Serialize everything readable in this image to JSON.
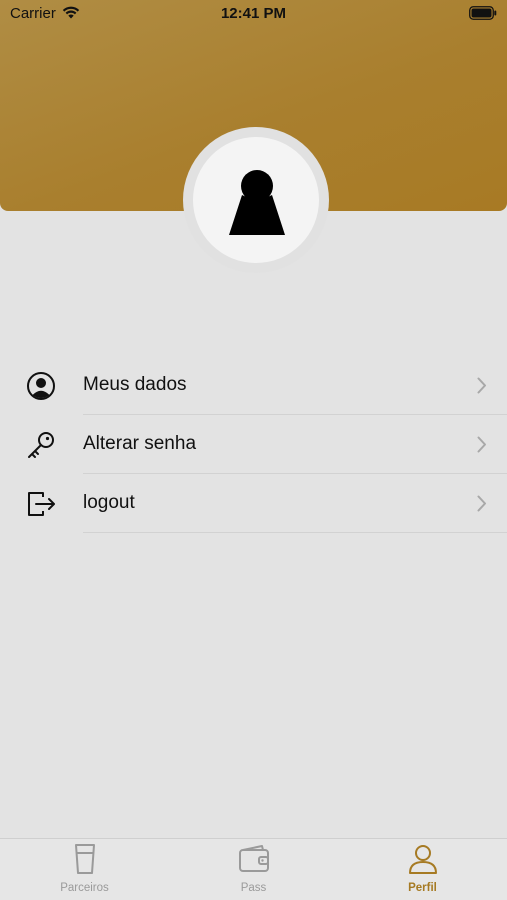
{
  "status_bar": {
    "carrier": "Carrier",
    "time": "12:41 PM"
  },
  "theme": {
    "accent": "#a67a23",
    "header_gradient": [
      "#b08d44",
      "#a87a24"
    ],
    "background": "#e3e3e3"
  },
  "profile": {
    "avatar_icon": "person-silhouette-icon"
  },
  "menu": {
    "items": [
      {
        "label": "Meus dados",
        "icon": "user-circle-icon"
      },
      {
        "label": "Alterar senha",
        "icon": "key-icon"
      },
      {
        "label": "logout",
        "icon": "logout-icon"
      }
    ]
  },
  "tab_bar": {
    "tabs": [
      {
        "label": "Parceiros",
        "icon": "beer-glass-icon",
        "active": false
      },
      {
        "label": "Pass",
        "icon": "wallet-icon",
        "active": false
      },
      {
        "label": "Perfil",
        "icon": "person-icon",
        "active": true
      }
    ]
  }
}
